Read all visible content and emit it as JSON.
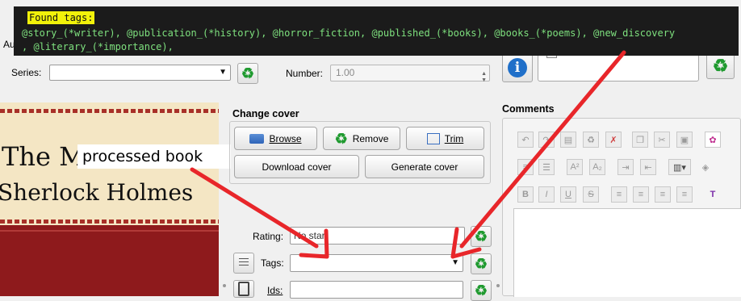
{
  "terminal": {
    "header": "Found tags:",
    "line1": "@story_(*writer), @publication_(*history), @horror_fiction, @published_(*books), @books_(*poems), @new_discovery",
    "line2": ", @literary_(*importance),"
  },
  "author_label_fragment": "Auth",
  "series": {
    "label": "Series:",
    "value": ""
  },
  "number": {
    "label": "Number:",
    "value": "1.00"
  },
  "change_cover": {
    "title": "Change cover",
    "browse": "Browse",
    "remove": "Remove",
    "trim": "Trim",
    "download": "Download cover",
    "generate": "Generate cover"
  },
  "cover_image": {
    "title_line1": "The M",
    "title_line2": "Sherlock Holmes"
  },
  "callout": "processed book",
  "rating": {
    "label": "Rating:",
    "value": "No star"
  },
  "tags": {
    "label": "Tags:",
    "value": ""
  },
  "ids": {
    "label": "Ids:",
    "value": ""
  },
  "comments": {
    "title": "Comments"
  },
  "icons": {
    "recycle": "♻",
    "info": "i",
    "annotation_color": "#e8262a",
    "highlight_color": "#f2f20a"
  }
}
